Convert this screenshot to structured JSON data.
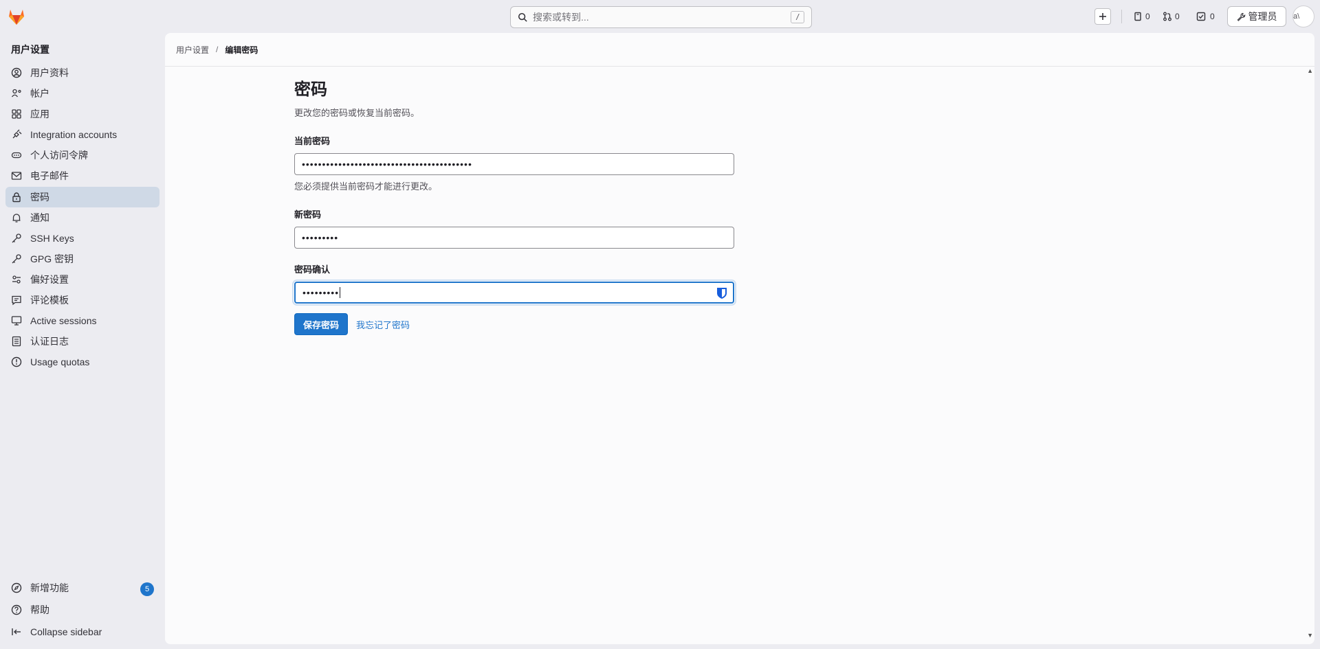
{
  "topbar": {
    "search_placeholder": "搜索或转到...",
    "search_shortcut": "/",
    "issues_count": "0",
    "merge_requests_count": "0",
    "todos_count": "0",
    "admin_label": "管理员",
    "avatar_alt": "a\\"
  },
  "sidebar": {
    "title": "用户设置",
    "items": [
      {
        "label": "用户资料",
        "icon": "profile-icon"
      },
      {
        "label": "帐户",
        "icon": "account-icon"
      },
      {
        "label": "应用",
        "icon": "applications-icon"
      },
      {
        "label": "Integration accounts",
        "icon": "integration-icon"
      },
      {
        "label": "个人访问令牌",
        "icon": "token-icon"
      },
      {
        "label": "电子邮件",
        "icon": "mail-icon"
      },
      {
        "label": "密码",
        "icon": "lock-icon"
      },
      {
        "label": "通知",
        "icon": "bell-icon"
      },
      {
        "label": "SSH Keys",
        "icon": "key-icon"
      },
      {
        "label": "GPG 密钥",
        "icon": "key-icon"
      },
      {
        "label": "偏好设置",
        "icon": "preferences-icon"
      },
      {
        "label": "评论模板",
        "icon": "comment-icon"
      },
      {
        "label": "Active sessions",
        "icon": "monitor-icon"
      },
      {
        "label": "认证日志",
        "icon": "log-icon"
      },
      {
        "label": "Usage quotas",
        "icon": "quota-icon"
      }
    ],
    "active_index": 6,
    "bottom": {
      "whats_new_label": "新增功能",
      "whats_new_count": "5",
      "help_label": "帮助",
      "collapse_label": "Collapse sidebar"
    }
  },
  "breadcrumb": {
    "parent": "用户设置",
    "separator": "/",
    "current": "编辑密码"
  },
  "form": {
    "title": "密码",
    "description": "更改您的密码或恢复当前密码。",
    "current_password_label": "当前密码",
    "current_password_value": "••••••••••••••••••••••••••••••••••••••••••",
    "current_password_help": "您必须提供当前密码才能进行更改。",
    "new_password_label": "新密码",
    "new_password_value": "•••••••••",
    "confirm_password_label": "密码确认",
    "confirm_password_value": "•••••••••",
    "save_button": "保存密码",
    "forgot_link": "我忘记了密码"
  },
  "colors": {
    "primary": "#1f75cb",
    "sidebar_active": "#cfd9e6",
    "logo_orange": "#e24329"
  }
}
